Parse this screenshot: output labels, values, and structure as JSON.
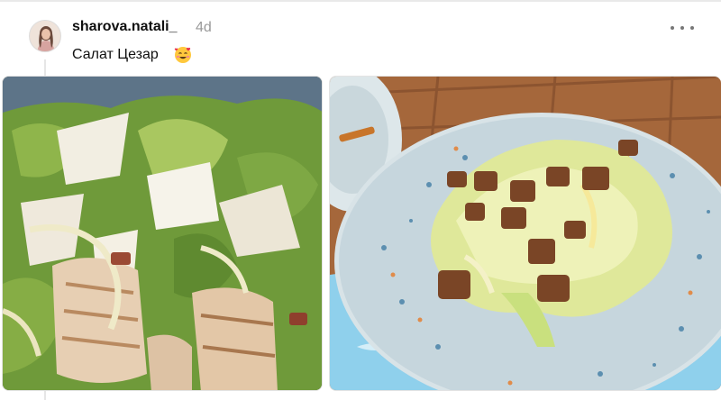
{
  "post": {
    "username": "sharova.natali_",
    "time": "4d",
    "caption": "Салат Цезар",
    "emoji_icon": "smiling-face-with-hearts-emoji",
    "more_icon": "more-horizontal-icon"
  },
  "photos": [
    {
      "name": "caesar-salad-chicken-closeup"
    },
    {
      "name": "caesar-salad-croutons-plate"
    }
  ],
  "colors": {
    "text": "#101010",
    "muted": "#999999",
    "divider": "#e6e6e6"
  }
}
